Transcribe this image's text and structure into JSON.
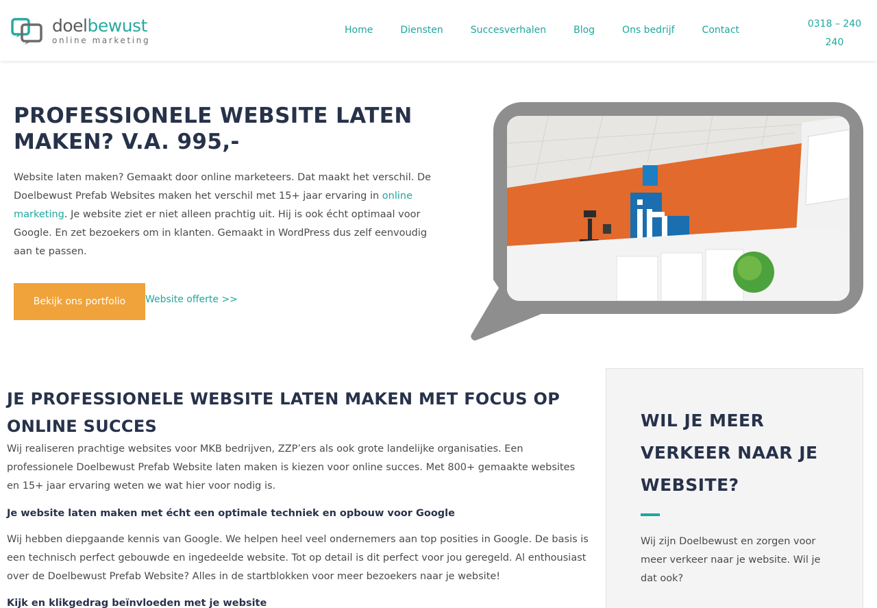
{
  "logo": {
    "word_dark": "doel",
    "word_teal": "bewust",
    "sub": "online marketing"
  },
  "nav": {
    "items": [
      {
        "label": "Home"
      },
      {
        "label": "Diensten"
      },
      {
        "label": "Succesverhalen"
      },
      {
        "label": "Blog"
      },
      {
        "label": "Ons bedrijf"
      },
      {
        "label": "Contact"
      }
    ],
    "phone_line1": "0318 – 240",
    "phone_line2": "240"
  },
  "hero": {
    "title": "PROFESSIONELE WEBSITE LATEN MAKEN? V.A. 995,-",
    "text_before_link": "Website laten maken? Gemaakt door online marketeers. Dat maakt het verschil. De Doelbewust Prefab Websites maken het verschil met 15+ jaar ervaring in ",
    "link": "online marketing",
    "text_after_link": ". Je website ziet er niet alleen prachtig uit. Hij is ook écht optimaal voor Google. En zet bezoekers om in klanten. Gemaakt in WordPress dus zelf eenvoudig aan te passen.",
    "button": "Bekijk ons portfolio",
    "secondary_link": "Website offerte >>"
  },
  "section2": {
    "title": "JE PROFESSIONELE WEBSITE LATEN MAKEN MET FOCUS OP ONLINE SUCCES",
    "p1": "Wij realiseren prachtige websites voor MKB bedrijven, ZZP’ers als ook grote landelijke organisaties. Een professionele Doelbewust Prefab Website laten maken is kiezen voor online succes. Met 800+ gemaakte websites en 15+ jaar ervaring weten we wat hier voor nodig is.",
    "h1": "Je website laten maken met écht een optimale techniek en opbouw voor Google",
    "p2": "Wij hebben diepgaande kennis van Google. We helpen heel veel ondernemers aan top posities in Google. De basis is een technisch perfect gebouwde en ingedeelde website. Tot op detail is dit perfect voor jou geregeld. Al enthousiast over de Doelbewust Prefab Website? Alles in de startblokken voor meer bezoekers naar je website!",
    "h2": "Kijk en klikgedrag beïnvloeden met je website"
  },
  "sidebar": {
    "title": "WIL JE MEER VERKEER NAAR JE WEBSITE?",
    "text": "Wij zijn Doelbewust en zorgen voor meer verkeer naar je website. Wil je dat ook?"
  },
  "colors": {
    "teal": "#1ea79d",
    "orange": "#f0a33a",
    "navy": "#27324a",
    "bubble_gray": "#8e8e8e"
  }
}
